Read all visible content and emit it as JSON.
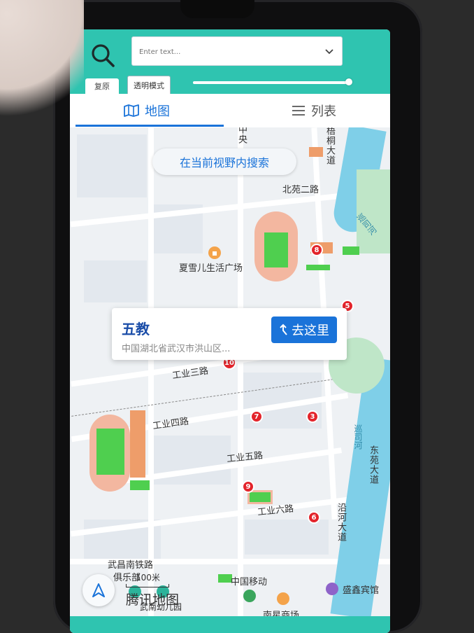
{
  "search": {
    "placeholder": "Enter text..."
  },
  "toolbar": {
    "reset_label": "复原",
    "transparent_label": "透明模式",
    "slider_value": 1.0
  },
  "tabs": {
    "map_label": "地图",
    "list_label": "列表",
    "active": "map"
  },
  "map": {
    "search_here_label": "在当前视野内搜索",
    "roads": {
      "wutong": "梧桐大道",
      "north_garden_2": "北苑二路",
      "industrial_3": "工业三路",
      "industrial_4": "工业四路",
      "industrial_5": "工业五路",
      "industrial_6": "工业六路",
      "dongyuan": "东苑大道",
      "yanhe": "沿河大道",
      "zhong": "中央"
    },
    "rivers": {
      "river_top": "巡司河",
      "river_mid": "巡司河"
    },
    "pois": {
      "xiaxueer": "夏雪儿生活广场",
      "railway_club_line1": "武昌南铁路",
      "railway_club_line2": "俱乐部",
      "china_mobile": "中国移动",
      "shengxin_hotel": "盛鑫宾馆",
      "nanxing_mall": "南星商场",
      "kindergarten": "武南幼儿园"
    },
    "markers": [
      "8",
      "5",
      "7",
      "3",
      "9",
      "6"
    ],
    "selected_marker": "10",
    "popup": {
      "title": "五教",
      "address": "中国湖北省武汉市洪山区...",
      "go_label": "去这里"
    },
    "scale_label": "100米",
    "brand": "腾讯地图"
  },
  "colors": {
    "teal": "#2fc4b0",
    "blue": "#1a73d9",
    "marker_red": "#e3242b"
  }
}
